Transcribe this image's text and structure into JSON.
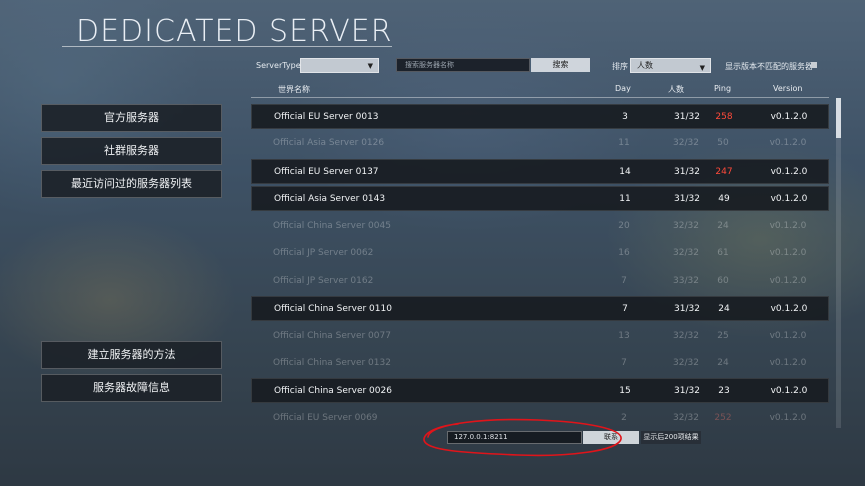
{
  "title": "DEDICATED SERVER",
  "filters": {
    "server_type_label": "ServerType",
    "server_type_value": "",
    "search_placeholder": "搜索服务器名称",
    "search_button": "搜索",
    "sort_label": "排序",
    "sort_value": "人数",
    "show_mismatch_label": "显示版本不匹配的服务器"
  },
  "menu": {
    "official": "官方服务器",
    "community": "社群服务器",
    "recent": "最近访问过的服务器列表",
    "how_to": "建立服务器的方法",
    "troubleshoot": "服务器故障信息"
  },
  "table": {
    "headers": {
      "name": "世界名称",
      "day": "Day",
      "players": "人数",
      "ping": "Ping",
      "version": "Version"
    },
    "rows": [
      {
        "name": "Official EU Server 0013",
        "day": "3",
        "players": "31/32",
        "ping": "258",
        "version": "v0.1.2.0"
      },
      {
        "name": "Official Asia Server 0126",
        "day": "11",
        "players": "32/32",
        "ping": "50",
        "version": "v0.1.2.0"
      },
      {
        "name": "Official EU Server 0137",
        "day": "14",
        "players": "31/32",
        "ping": "247",
        "version": "v0.1.2.0"
      },
      {
        "name": "Official Asia Server 0143",
        "day": "11",
        "players": "31/32",
        "ping": "49",
        "version": "v0.1.2.0"
      },
      {
        "name": "Official China Server 0045",
        "day": "20",
        "players": "32/32",
        "ping": "24",
        "version": "v0.1.2.0"
      },
      {
        "name": "Official JP Server 0062",
        "day": "16",
        "players": "32/32",
        "ping": "61",
        "version": "v0.1.2.0"
      },
      {
        "name": "Official JP Server 0162",
        "day": "7",
        "players": "33/32",
        "ping": "60",
        "version": "v0.1.2.0"
      },
      {
        "name": "Official China Server 0110",
        "day": "7",
        "players": "31/32",
        "ping": "24",
        "version": "v0.1.2.0"
      },
      {
        "name": "Official China Server 0077",
        "day": "13",
        "players": "32/32",
        "ping": "25",
        "version": "v0.1.2.0"
      },
      {
        "name": "Official China Server 0132",
        "day": "7",
        "players": "32/32",
        "ping": "24",
        "version": "v0.1.2.0"
      },
      {
        "name": "Official China Server 0026",
        "day": "15",
        "players": "31/32",
        "ping": "23",
        "version": "v0.1.2.0"
      },
      {
        "name": "Official EU Server 0069",
        "day": "2",
        "players": "32/32",
        "ping": "252",
        "version": "v0.1.2.0"
      }
    ]
  },
  "connect": {
    "ip_value": "127.0.0.1:8211",
    "connect_button": "联系",
    "show_more_button": "显示后200项结果"
  }
}
